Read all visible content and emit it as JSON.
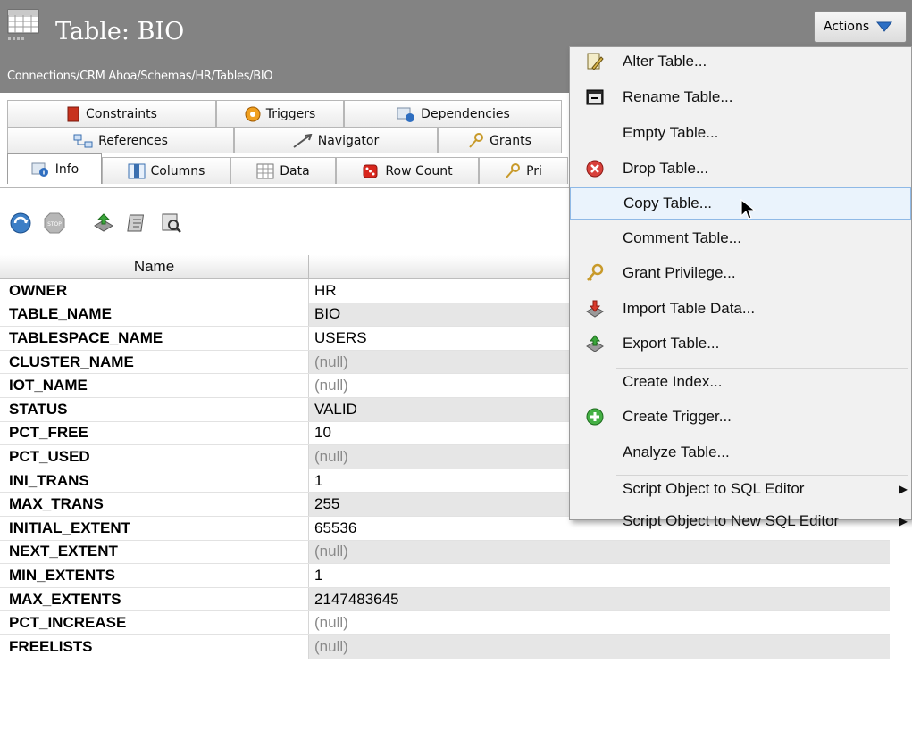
{
  "header": {
    "title": "Table: BIO",
    "breadcrumb": "Connections/CRM Ahoa/Schemas/HR/Tables/BIO",
    "actions_label": "Actions"
  },
  "tabs": {
    "row1": [
      {
        "label": "Constraints",
        "icon": "constraints-icon"
      },
      {
        "label": "Triggers",
        "icon": "triggers-icon"
      },
      {
        "label": "Dependencies",
        "icon": "dependencies-icon"
      }
    ],
    "row2": [
      {
        "label": "References",
        "icon": "references-icon"
      },
      {
        "label": "Navigator",
        "icon": "navigator-icon"
      },
      {
        "label": "Grants",
        "icon": "grants-key-icon"
      }
    ],
    "row3": [
      {
        "label": "Info",
        "icon": "info-icon",
        "active": true
      },
      {
        "label": "Columns",
        "icon": "columns-icon"
      },
      {
        "label": "Data",
        "icon": "data-grid-icon"
      },
      {
        "label": "Row Count",
        "icon": "row-count-icon"
      },
      {
        "label": "Pri",
        "icon": "privileges-key-icon"
      }
    ]
  },
  "toolbar": {
    "icons": [
      "refresh-icon",
      "stop-icon",
      "export-icon",
      "script-icon",
      "find-icon"
    ]
  },
  "grid": {
    "columns": [
      "Name",
      ""
    ],
    "rows": [
      {
        "name": "OWNER",
        "value": "HR"
      },
      {
        "name": "TABLE_NAME",
        "value": "BIO"
      },
      {
        "name": "TABLESPACE_NAME",
        "value": "USERS"
      },
      {
        "name": "CLUSTER_NAME",
        "value": "(null)"
      },
      {
        "name": "IOT_NAME",
        "value": "(null)"
      },
      {
        "name": "STATUS",
        "value": "VALID"
      },
      {
        "name": "PCT_FREE",
        "value": "10"
      },
      {
        "name": "PCT_USED",
        "value": "(null)"
      },
      {
        "name": "INI_TRANS",
        "value": "1"
      },
      {
        "name": "MAX_TRANS",
        "value": "255"
      },
      {
        "name": "INITIAL_EXTENT",
        "value": "65536"
      },
      {
        "name": "NEXT_EXTENT",
        "value": "(null)"
      },
      {
        "name": "MIN_EXTENTS",
        "value": "1"
      },
      {
        "name": "MAX_EXTENTS",
        "value": "2147483645"
      },
      {
        "name": "PCT_INCREASE",
        "value": "(null)"
      },
      {
        "name": "FREELISTS",
        "value": "(null)"
      }
    ]
  },
  "menu": {
    "items": [
      {
        "label": "Alter Table...",
        "icon": "alter-table-icon"
      },
      {
        "label": "Rename Table...",
        "icon": "rename-table-icon"
      },
      {
        "label": "Empty Table...",
        "icon": ""
      },
      {
        "label": "Drop Table...",
        "icon": "drop-table-icon"
      },
      {
        "label": "Copy Table...",
        "icon": "",
        "highlighted": true
      },
      {
        "label": "Comment Table...",
        "icon": ""
      },
      {
        "label": "Grant Privilege...",
        "icon": "grant-key-icon"
      },
      {
        "label": "Import Table Data...",
        "icon": "import-icon"
      },
      {
        "label": "Export Table...",
        "icon": "export-icon"
      },
      {
        "label": "Create Index...",
        "icon": ""
      },
      {
        "label": "Create Trigger...",
        "icon": "create-trigger-icon"
      },
      {
        "label": "Analyze Table...",
        "icon": ""
      },
      {
        "label": "Script Object to SQL Editor",
        "icon": "",
        "submenu": true
      },
      {
        "label": "Script Object to New SQL Editor",
        "icon": "",
        "submenu": true
      }
    ]
  },
  "colors": {
    "header_bg": "#838383",
    "menu_highlight": "#eaf3fc",
    "null_text": "#8a8a8a",
    "alt_row": "#e6e6e6"
  }
}
